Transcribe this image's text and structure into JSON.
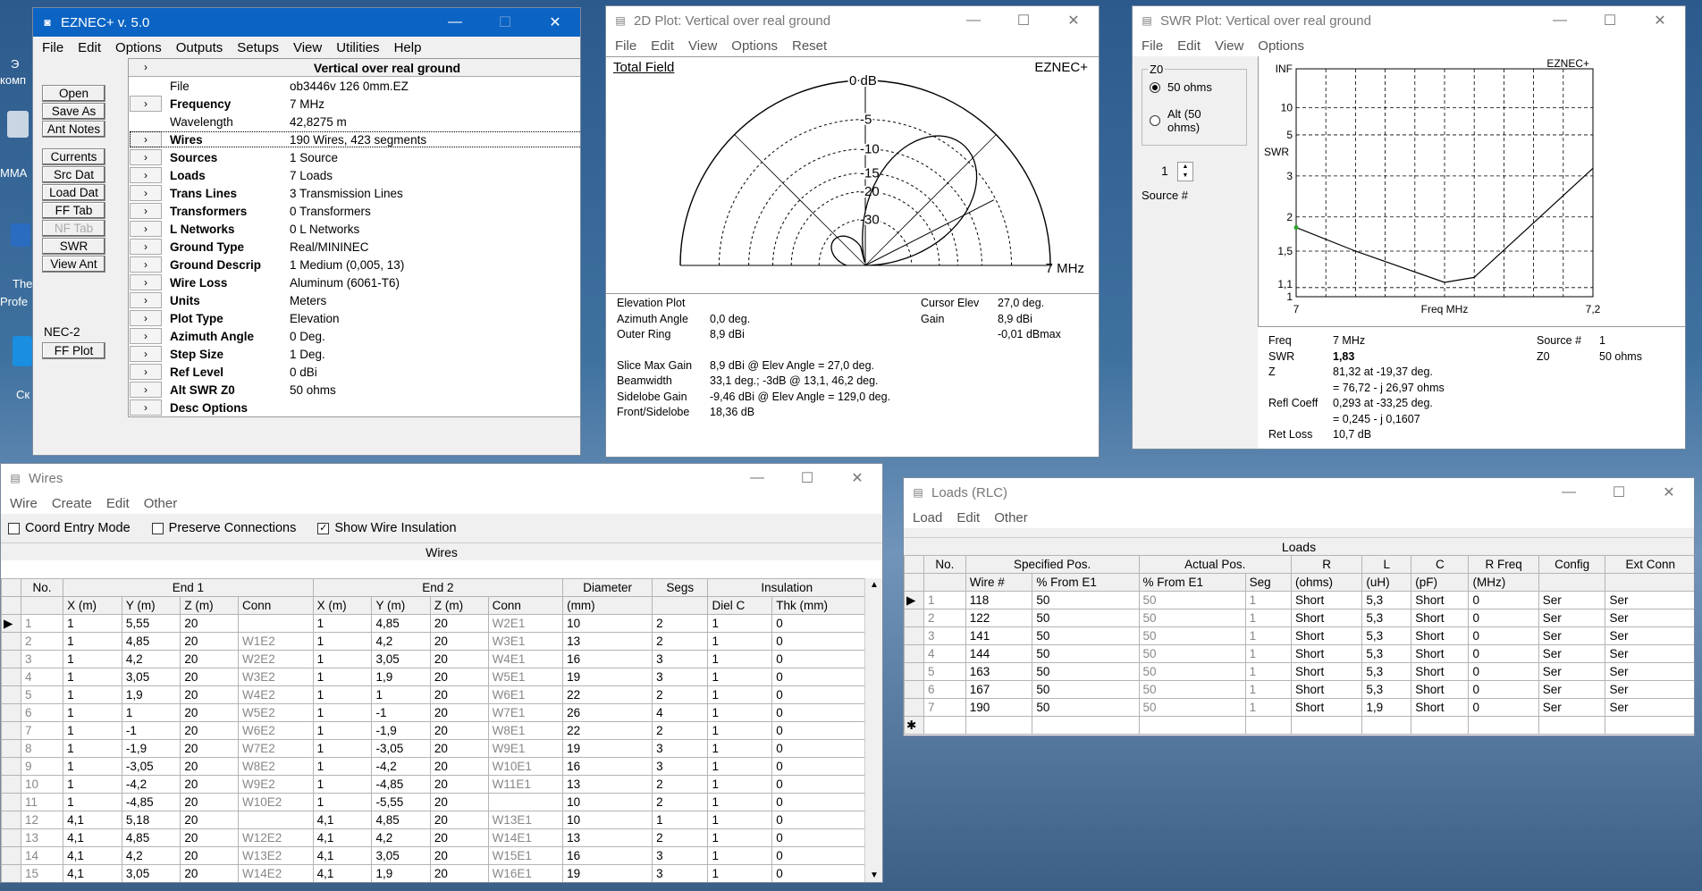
{
  "main": {
    "title": "EZNEC+  v. 5.0",
    "menu": [
      "File",
      "Edit",
      "Options",
      "Outputs",
      "Setups",
      "View",
      "Utilities",
      "Help"
    ],
    "buttons": [
      "Open",
      "Save As",
      "Ant Notes",
      "Currents",
      "Src Dat",
      "Load Dat",
      "FF Tab",
      "NF Tab",
      "SWR",
      "View Ant"
    ],
    "nec_label": "NEC-2",
    "ffplot": "FF Plot",
    "header": "Vertical over real ground",
    "rows": [
      [
        "File",
        "ob3446v 126 0mm.EZ"
      ],
      [
        "Frequency",
        "7 MHz"
      ],
      [
        "Wavelength",
        "42,8275 m"
      ],
      [
        "Wires",
        "190 Wires, 423 segments"
      ],
      [
        "Sources",
        "1 Source"
      ],
      [
        "Loads",
        "7 Loads"
      ],
      [
        "Trans Lines",
        "3 Transmission Lines"
      ],
      [
        "Transformers",
        "0 Transformers"
      ],
      [
        "L Networks",
        "0 L Networks"
      ],
      [
        "Ground Type",
        "Real/MININEC"
      ],
      [
        "Ground Descrip",
        "1 Medium (0,005, 13)"
      ],
      [
        "Wire Loss",
        "Aluminum (6061-T6)"
      ],
      [
        "Units",
        "Meters"
      ],
      [
        "Plot Type",
        "Elevation"
      ],
      [
        "Azimuth Angle",
        "0 Deg."
      ],
      [
        "Step Size",
        "1 Deg."
      ],
      [
        "Ref Level",
        "0 dBi"
      ],
      [
        "Alt SWR Z0",
        "50 ohms"
      ],
      [
        "Desc Options",
        ""
      ]
    ]
  },
  "plot2d": {
    "title": "2D Plot: Vertical over real ground",
    "menu": [
      "File",
      "Edit",
      "View",
      "Options",
      "Reset"
    ],
    "total_field": "Total Field",
    "brand": "EZNEC+",
    "freq": "7 MHz",
    "ring_labels": [
      "0 dB",
      "-5",
      "-10",
      "-15",
      "-20",
      "-30"
    ],
    "left": [
      [
        "Elevation Plot",
        ""
      ],
      [
        "Azimuth Angle",
        "0,0 deg."
      ],
      [
        "Outer Ring",
        "8,9 dBi"
      ],
      [
        "",
        ""
      ],
      [
        "Slice Max Gain",
        "8,9 dBi @ Elev Angle = 27,0 deg."
      ],
      [
        "Beamwidth",
        "33,1 deg.; -3dB @ 13,1, 46,2 deg."
      ],
      [
        "Sidelobe Gain",
        "-9,46 dBi @ Elev Angle = 129,0 deg."
      ],
      [
        "Front/Sidelobe",
        "18,36 dB"
      ]
    ],
    "right": [
      [
        "Cursor Elev",
        "27,0 deg."
      ],
      [
        "Gain",
        "8,9 dBi"
      ],
      [
        "",
        "-0,01 dBmax"
      ]
    ]
  },
  "swr": {
    "title": "SWR Plot: Vertical over real ground",
    "menu": [
      "File",
      "Edit",
      "View",
      "Options"
    ],
    "z0_label": "Z0",
    "opt1": "50 ohms",
    "opt2": "Alt (50 ohms)",
    "source_num": "1",
    "source_label": "Source #",
    "brand": "EZNEC+",
    "ylabel": "SWR",
    "xlabel": "Freq MHz",
    "info": [
      [
        "Freq",
        "7 MHz",
        "Source #",
        "1"
      ],
      [
        "SWR",
        "1,83",
        "Z0",
        "50 ohms"
      ],
      [
        "Z",
        "81,32 at -19,37 deg.",
        "",
        ""
      ],
      [
        "",
        "= 76,72 - j 26,97 ohms",
        "",
        ""
      ],
      [
        "Refl Coeff",
        "0,293 at -33,25 deg.",
        "",
        ""
      ],
      [
        "",
        "= 0,245 - j 0,1607",
        "",
        ""
      ],
      [
        "Ret Loss",
        "10,7 dB",
        "",
        ""
      ]
    ]
  },
  "chart_data": {
    "type": "line",
    "xlabel": "Freq MHz",
    "ylabel": "SWR",
    "x": [
      7,
      7.1,
      7.2
    ],
    "values": [
      1.83,
      1.15,
      3.3
    ],
    "x_ticks": [
      "7",
      "7,2"
    ],
    "y_ticks": [
      "INF",
      "10",
      "5",
      "3",
      "2",
      "1,5",
      "1,1",
      "1"
    ],
    "xlim": [
      7,
      7.2
    ],
    "log_y": true,
    "grid": true
  },
  "wires": {
    "title": "Wires",
    "menu": [
      "Wire",
      "Create",
      "Edit",
      "Other"
    ],
    "checks": [
      "Coord Entry Mode",
      "Preserve Connections",
      "Show Wire Insulation"
    ],
    "caption": "Wires",
    "groups": [
      "No.",
      "End 1",
      "End 2",
      "Diameter",
      "Segs",
      "Insulation"
    ],
    "cols": [
      "X (m)",
      "Y (m)",
      "Z (m)",
      "Conn",
      "X (m)",
      "Y (m)",
      "Z (m)",
      "Conn",
      "(mm)",
      "Diel C",
      "Thk (mm)"
    ],
    "rows": [
      [
        "1",
        "1",
        "5,55",
        "20",
        "",
        "1",
        "4,85",
        "20",
        "W2E1",
        "10",
        "2",
        "1",
        "0"
      ],
      [
        "2",
        "1",
        "4,85",
        "20",
        "W1E2",
        "1",
        "4,2",
        "20",
        "W3E1",
        "13",
        "2",
        "1",
        "0"
      ],
      [
        "3",
        "1",
        "4,2",
        "20",
        "W2E2",
        "1",
        "3,05",
        "20",
        "W4E1",
        "16",
        "3",
        "1",
        "0"
      ],
      [
        "4",
        "1",
        "3,05",
        "20",
        "W3E2",
        "1",
        "1,9",
        "20",
        "W5E1",
        "19",
        "3",
        "1",
        "0"
      ],
      [
        "5",
        "1",
        "1,9",
        "20",
        "W4E2",
        "1",
        "1",
        "20",
        "W6E1",
        "22",
        "2",
        "1",
        "0"
      ],
      [
        "6",
        "1",
        "1",
        "20",
        "W5E2",
        "1",
        "-1",
        "20",
        "W7E1",
        "26",
        "4",
        "1",
        "0"
      ],
      [
        "7",
        "1",
        "-1",
        "20",
        "W6E2",
        "1",
        "-1,9",
        "20",
        "W8E1",
        "22",
        "2",
        "1",
        "0"
      ],
      [
        "8",
        "1",
        "-1,9",
        "20",
        "W7E2",
        "1",
        "-3,05",
        "20",
        "W9E1",
        "19",
        "3",
        "1",
        "0"
      ],
      [
        "9",
        "1",
        "-3,05",
        "20",
        "W8E2",
        "1",
        "-4,2",
        "20",
        "W10E1",
        "16",
        "3",
        "1",
        "0"
      ],
      [
        "10",
        "1",
        "-4,2",
        "20",
        "W9E2",
        "1",
        "-4,85",
        "20",
        "W11E1",
        "13",
        "2",
        "1",
        "0"
      ],
      [
        "11",
        "1",
        "-4,85",
        "20",
        "W10E2",
        "1",
        "-5,55",
        "20",
        "",
        "10",
        "2",
        "1",
        "0"
      ],
      [
        "12",
        "4,1",
        "5,18",
        "20",
        "",
        "4,1",
        "4,85",
        "20",
        "W13E1",
        "10",
        "1",
        "1",
        "0"
      ],
      [
        "13",
        "4,1",
        "4,85",
        "20",
        "W12E2",
        "4,1",
        "4,2",
        "20",
        "W14E1",
        "13",
        "2",
        "1",
        "0"
      ],
      [
        "14",
        "4,1",
        "4,2",
        "20",
        "W13E2",
        "4,1",
        "3,05",
        "20",
        "W15E1",
        "16",
        "3",
        "1",
        "0"
      ],
      [
        "15",
        "4,1",
        "3,05",
        "20",
        "W14E2",
        "4,1",
        "1,9",
        "20",
        "W16E1",
        "19",
        "3",
        "1",
        "0"
      ]
    ]
  },
  "loads": {
    "title": "Loads (RLC)",
    "menu": [
      "Load",
      "Edit",
      "Other"
    ],
    "caption": "Loads",
    "groups": [
      "No.",
      "Specified Pos.",
      "Actual Pos.",
      "R",
      "L",
      "C",
      "R Freq",
      "Config",
      "Ext Conn"
    ],
    "cols": [
      "Wire #",
      "% From E1",
      "% From E1",
      "Seg",
      "(ohms)",
      "(uH)",
      "(pF)",
      "(MHz)"
    ],
    "rows": [
      [
        "1",
        "118",
        "50",
        "50",
        "1",
        "Short",
        "5,3",
        "Short",
        "0",
        "Ser",
        "Ser"
      ],
      [
        "2",
        "122",
        "50",
        "50",
        "1",
        "Short",
        "5,3",
        "Short",
        "0",
        "Ser",
        "Ser"
      ],
      [
        "3",
        "141",
        "50",
        "50",
        "1",
        "Short",
        "5,3",
        "Short",
        "0",
        "Ser",
        "Ser"
      ],
      [
        "4",
        "144",
        "50",
        "50",
        "1",
        "Short",
        "5,3",
        "Short",
        "0",
        "Ser",
        "Ser"
      ],
      [
        "5",
        "163",
        "50",
        "50",
        "1",
        "Short",
        "5,3",
        "Short",
        "0",
        "Ser",
        "Ser"
      ],
      [
        "6",
        "167",
        "50",
        "50",
        "1",
        "Short",
        "5,3",
        "Short",
        "0",
        "Ser",
        "Ser"
      ],
      [
        "7",
        "190",
        "50",
        "50",
        "1",
        "Short",
        "1,9",
        "Short",
        "0",
        "Ser",
        "Ser"
      ]
    ]
  },
  "desktop": {
    "labels": [
      "Э",
      "комп",
      "MMA",
      "The",
      "Profe",
      "Ск"
    ]
  }
}
